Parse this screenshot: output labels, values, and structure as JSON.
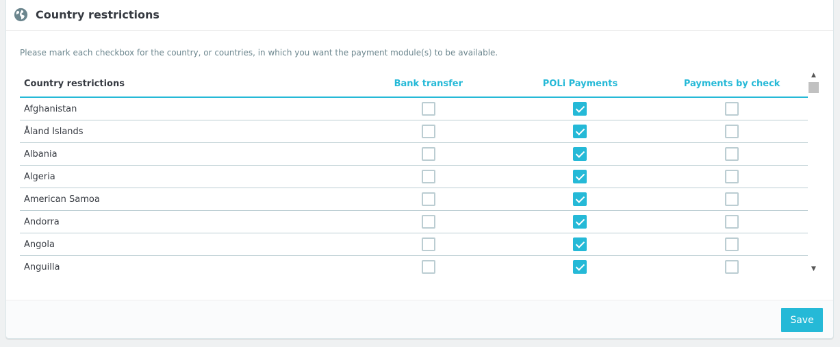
{
  "panel": {
    "title": "Country restrictions",
    "icon": "globe-icon",
    "help_text": "Please mark each checkbox for the country, or countries, in which you want the payment module(s) to be available."
  },
  "table": {
    "headers": {
      "country": "Country restrictions",
      "modules": [
        "Bank transfer",
        "POLi Payments",
        "Payments by check"
      ]
    },
    "rows": [
      {
        "country": "Afghanistan",
        "checks": [
          false,
          true,
          false
        ]
      },
      {
        "country": "Åland Islands",
        "checks": [
          false,
          true,
          false
        ]
      },
      {
        "country": "Albania",
        "checks": [
          false,
          true,
          false
        ]
      },
      {
        "country": "Algeria",
        "checks": [
          false,
          true,
          false
        ]
      },
      {
        "country": "American Samoa",
        "checks": [
          false,
          true,
          false
        ]
      },
      {
        "country": "Andorra",
        "checks": [
          false,
          true,
          false
        ]
      },
      {
        "country": "Angola",
        "checks": [
          false,
          true,
          false
        ]
      },
      {
        "country": "Anguilla",
        "checks": [
          false,
          true,
          false
        ]
      }
    ]
  },
  "footer": {
    "save_label": "Save"
  },
  "colors": {
    "accent": "#25b9d7",
    "text": "#363a41",
    "muted": "#6c868e",
    "border": "#bbcdd2"
  }
}
